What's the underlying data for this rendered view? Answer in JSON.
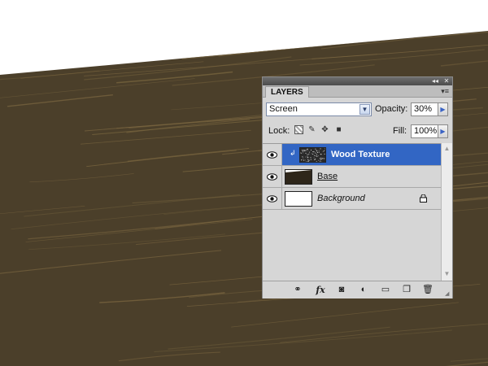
{
  "panel": {
    "tab_label": "LAYERS",
    "collapse_glyph": "◂◂",
    "close_glyph": "✕",
    "menu_glyph": "▾≡",
    "blend_mode": "Screen",
    "opacity_label": "Opacity:",
    "opacity_value": "30%",
    "lock_label": "Lock:",
    "fill_label": "Fill:",
    "fill_value": "100%"
  },
  "layers": [
    {
      "name": "Wood Texture",
      "selected": true,
      "bold": true,
      "italic": false,
      "underline": false,
      "visible": true,
      "clipped": true,
      "locked": false
    },
    {
      "name": "Base",
      "selected": false,
      "bold": false,
      "italic": false,
      "underline": true,
      "visible": true,
      "clipped": false,
      "locked": false
    },
    {
      "name": "Background",
      "selected": false,
      "bold": false,
      "italic": true,
      "underline": false,
      "visible": true,
      "clipped": false,
      "locked": true
    }
  ],
  "bottom_icons": [
    "link-layers-icon",
    "layer-style-fx-icon",
    "add-mask-icon",
    "adjustment-layer-icon",
    "new-group-icon",
    "new-layer-icon",
    "delete-layer-icon"
  ],
  "bottom_labels": {
    "fx": "fx"
  },
  "colors": {
    "wood_base": "#4b3f2a",
    "wood_grain": "#7a6640",
    "selection": "#3266c4",
    "panel_bg": "#d6d6d6"
  }
}
